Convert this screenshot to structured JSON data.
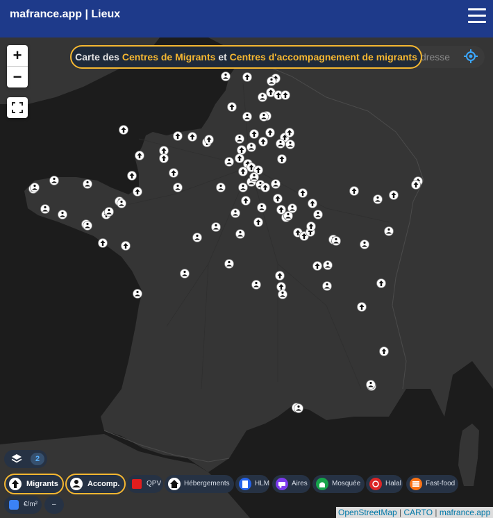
{
  "header": {
    "brand": "mafrance.app | Lieux",
    "menu_icon": "hamburger-menu-icon"
  },
  "map_controls": {
    "zoom_in": "+",
    "zoom_out": "−"
  },
  "search": {
    "placeholder": "dresse"
  },
  "banner": {
    "prefix": "Carte des ",
    "highlight_1": "Centres de Migrants",
    "middle": " et ",
    "highlight_2": "Centres d'accompagnement de migrants"
  },
  "layers": {
    "count": "2"
  },
  "filters": [
    {
      "label": "Migrants",
      "icon": "up-arrow-icon",
      "active": true
    },
    {
      "label": "Accomp.",
      "icon": "person-hands-icon",
      "active": true
    },
    {
      "label": "QPV",
      "icon": "red-square-icon",
      "color": "#e11d1d"
    },
    {
      "label": "Hébergements",
      "icon": "house-icon"
    },
    {
      "label": "HLM",
      "icon": "building-icon",
      "color": "#2563eb"
    },
    {
      "label": "Aires",
      "icon": "caravan-icon",
      "color": "#7c3aed"
    },
    {
      "label": "Mosquée",
      "icon": "mosque-icon",
      "color": "#16a34a"
    },
    {
      "label": "Halal",
      "icon": "halal-icon",
      "color": "#dc2626"
    },
    {
      "label": "Fast-food",
      "icon": "burger-icon",
      "color": "#f97316"
    },
    {
      "label": "€/m²",
      "icon": "price-icon",
      "color": "#3b82f6"
    },
    {
      "label": "–",
      "icon": ""
    }
  ],
  "attribution": {
    "osm": "OpenStreetMap",
    "sep1": " | ",
    "carto": "CARTO",
    "sep2": " | ",
    "site": "mafrance.app"
  },
  "colors": {
    "header": "#1e3a8a",
    "accent": "#f5b731",
    "map_bg": "#262626",
    "land": "#353535",
    "sea": "#1c1c1c"
  }
}
